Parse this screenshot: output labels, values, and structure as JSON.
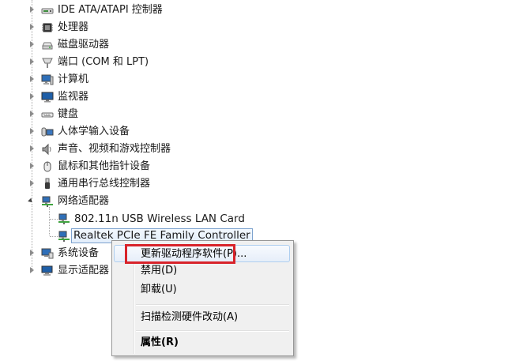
{
  "tree": {
    "items": [
      {
        "label": "IDE ATA/ATAPI 控制器",
        "icon": "ide-controller-icon",
        "state": "collapsed"
      },
      {
        "label": "处理器",
        "icon": "processor-icon",
        "state": "collapsed"
      },
      {
        "label": "磁盘驱动器",
        "icon": "disk-drive-icon",
        "state": "collapsed"
      },
      {
        "label": "端口 (COM 和 LPT)",
        "icon": "port-icon",
        "state": "collapsed"
      },
      {
        "label": "计算机",
        "icon": "computer-icon",
        "state": "collapsed"
      },
      {
        "label": "监视器",
        "icon": "monitor-icon",
        "state": "collapsed"
      },
      {
        "label": "键盘",
        "icon": "keyboard-icon",
        "state": "collapsed"
      },
      {
        "label": "人体学输入设备",
        "icon": "hid-icon",
        "state": "collapsed"
      },
      {
        "label": "声音、视频和游戏控制器",
        "icon": "speaker-icon",
        "state": "collapsed"
      },
      {
        "label": "鼠标和其他指针设备",
        "icon": "mouse-icon",
        "state": "collapsed"
      },
      {
        "label": "通用串行总线控制器",
        "icon": "usb-icon",
        "state": "collapsed"
      },
      {
        "label": "网络适配器",
        "icon": "network-adapter-icon",
        "state": "expanded"
      },
      {
        "label": "系统设备",
        "icon": "system-device-icon",
        "state": "collapsed"
      },
      {
        "label": "显示适配器",
        "icon": "display-adapter-icon",
        "state": "collapsed"
      }
    ],
    "network_children": [
      {
        "label": "802.11n USB Wireless LAN Card",
        "icon": "network-card-icon"
      },
      {
        "label": "Realtek PCIe FE Family Controller",
        "icon": "network-card-icon",
        "selected": true
      }
    ]
  },
  "context_menu": {
    "items": [
      {
        "label": "更新驱动程序软件(P)...",
        "hot": true
      },
      {
        "label": "禁用(D)"
      },
      {
        "label": "卸载(U)"
      },
      {
        "label": "扫描检测硬件改动(A)"
      },
      {
        "label": "属性(R)",
        "bold": true
      }
    ]
  },
  "colors": {
    "highlight_box": "#d8232a",
    "selection_border": "#7da2ce"
  }
}
